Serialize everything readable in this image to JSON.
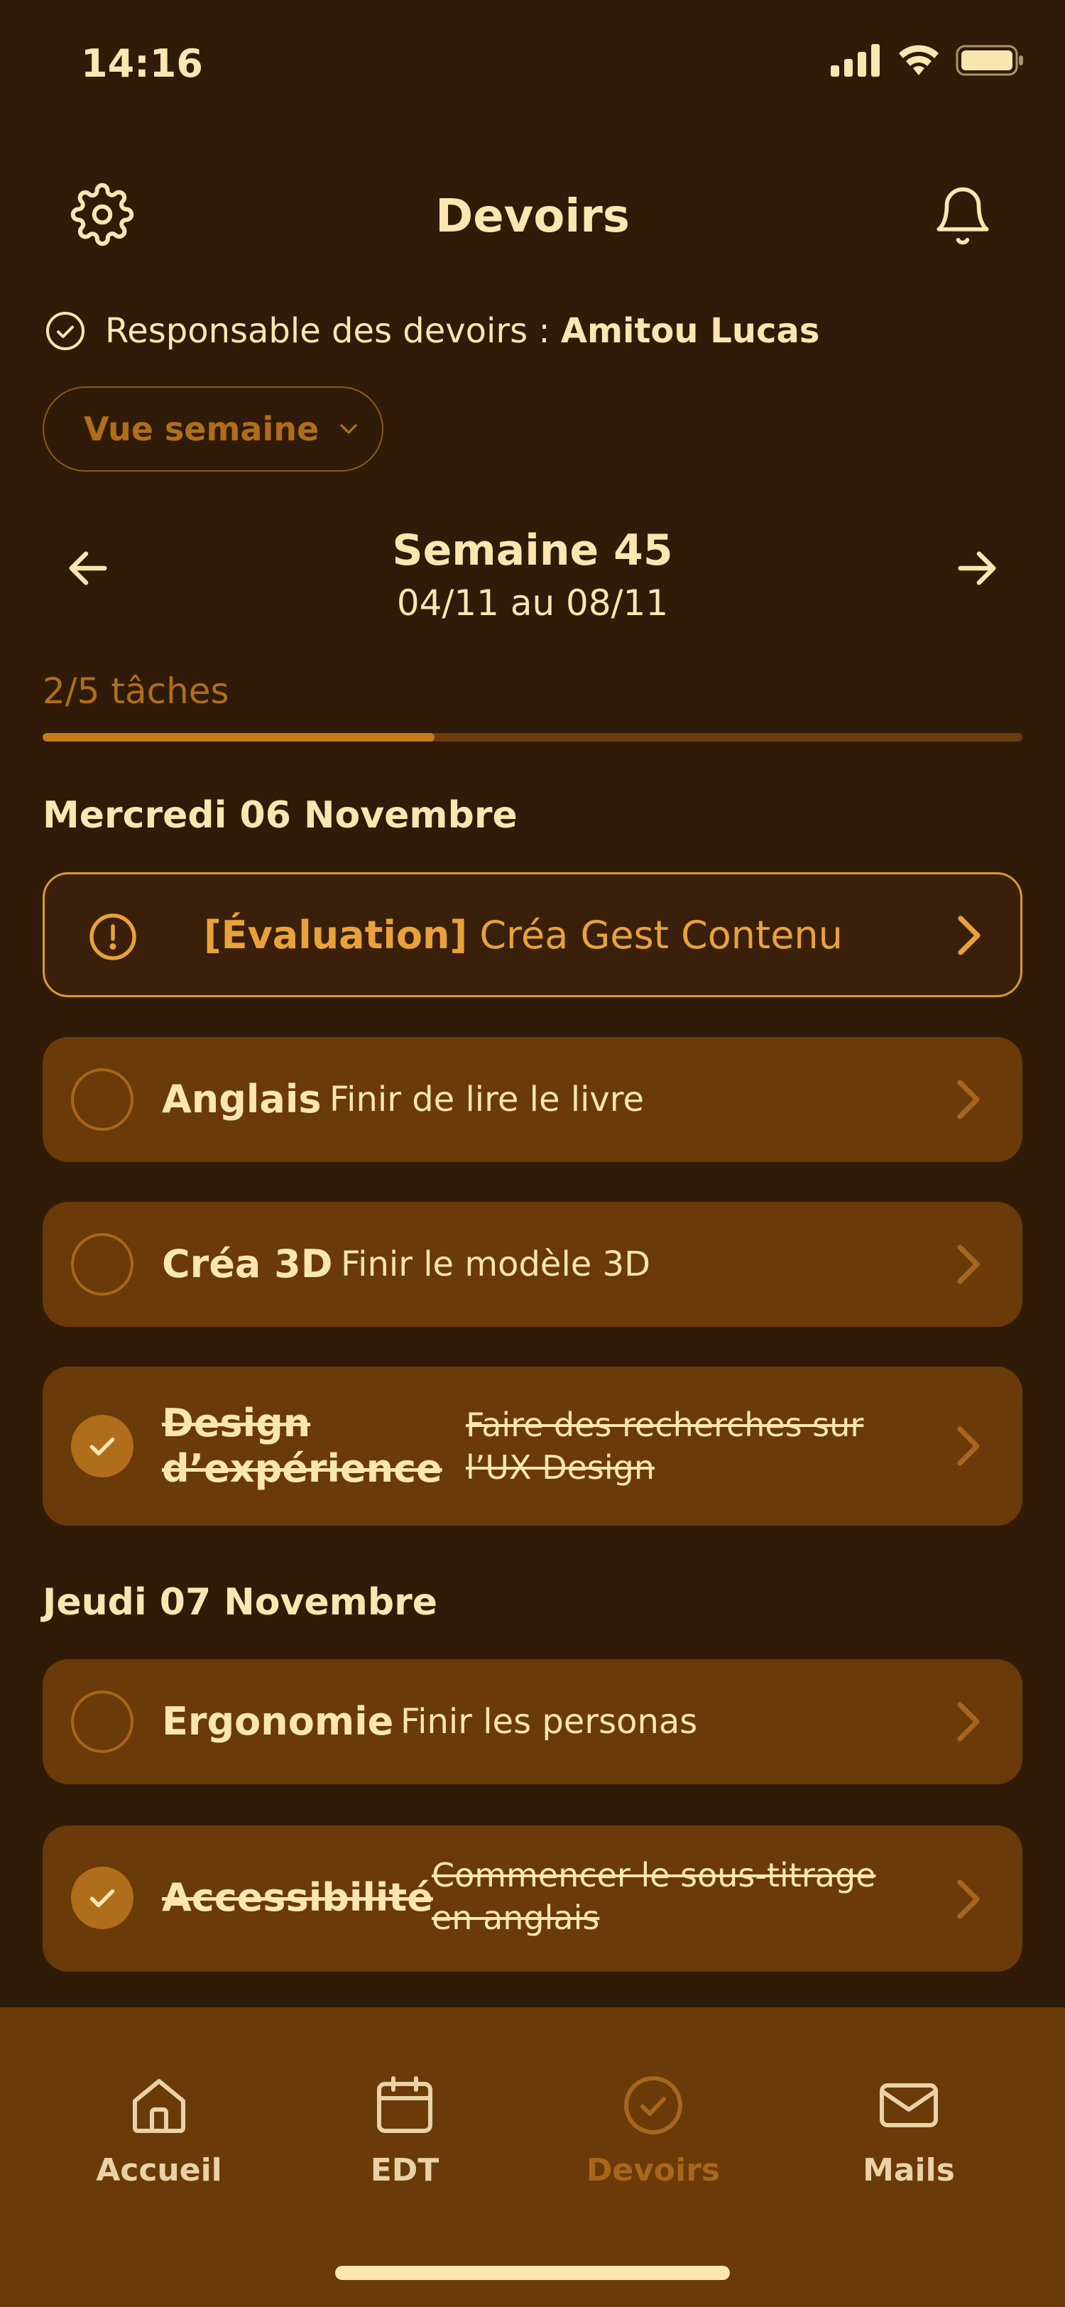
{
  "status_bar": {
    "time": "14:16"
  },
  "header": {
    "title": "Devoirs"
  },
  "responsible": {
    "label": "Responsable des devoirs :",
    "name": "Amitou Lucas"
  },
  "view_selector": {
    "value": "Vue semaine"
  },
  "week": {
    "title": "Semaine 45",
    "range": "04/11 au 08/11"
  },
  "progress": {
    "label": "2/5 tâches",
    "done": 2,
    "total": 5
  },
  "days": [
    {
      "heading": "Mercredi 06 Novembre",
      "evaluation": {
        "tag": "[Évaluation]",
        "text": "Créa Gest Contenu"
      },
      "tasks": [
        {
          "subject": "Anglais",
          "description": "Finir de lire le livre",
          "done": false
        },
        {
          "subject": "Créa 3D",
          "description": "Finir le modèle 3D",
          "done": false
        },
        {
          "subject": "Design d’expérience",
          "description": "Faire des recherches sur l’UX Design",
          "done": true
        }
      ]
    },
    {
      "heading": "Jeudi 07 Novembre",
      "tasks": [
        {
          "subject": "Ergonomie",
          "description": "Finir les personas",
          "done": false
        },
        {
          "subject": "Accessibilité",
          "description": "Commencer le sous-titrage en anglais",
          "done": true
        }
      ]
    }
  ],
  "bottom_nav": [
    {
      "label": "Accueil",
      "icon": "home-icon",
      "active": false
    },
    {
      "label": "EDT",
      "icon": "calendar-icon",
      "active": false
    },
    {
      "label": "Devoirs",
      "icon": "check-circle-icon",
      "active": true
    },
    {
      "label": "Mails",
      "icon": "mail-icon",
      "active": false
    }
  ],
  "colors": {
    "background": "#2f1b08",
    "card": "#6a3a08",
    "accent": "#b06e1a",
    "evaluation": "#e9a23a",
    "text": "#fbe6b0"
  }
}
